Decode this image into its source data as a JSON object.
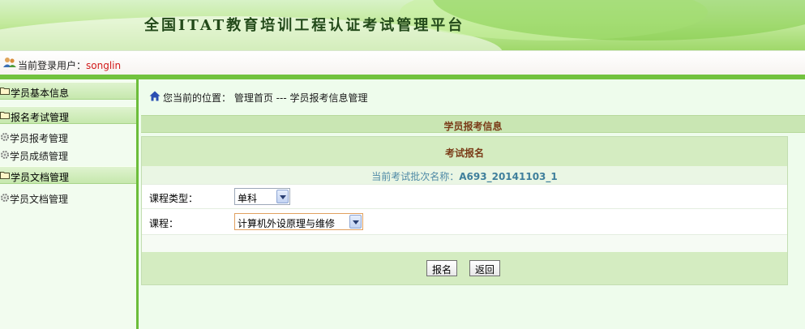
{
  "header": {
    "title": "全国ITAT教育培训工程认证考试管理平台"
  },
  "userbar": {
    "label": "当前登录用户：",
    "username": "songlin",
    "icon": "users-icon"
  },
  "sidebar": {
    "sections": [
      {
        "label": "学员基本信息",
        "icon": "folder-icon"
      },
      {
        "label": "报名考试管理",
        "icon": "folder-icon"
      },
      {
        "label": "学员文档管理",
        "icon": "folder-icon"
      }
    ],
    "items": [
      {
        "label": "学员报考管理",
        "icon": "gear-icon"
      },
      {
        "label": "学员成绩管理",
        "icon": "gear-icon"
      },
      {
        "label": "学员文档管理",
        "icon": "gear-icon"
      }
    ]
  },
  "breadcrumb": {
    "prefix": "您当前的位置：",
    "path": "管理首页 --- 学员报考信息管理",
    "icon": "home-icon"
  },
  "main": {
    "section_title": "学员报考信息",
    "panel_title": "考试报名",
    "batch_label": "当前考试批次名称：",
    "batch_value": "A693_20141103_1",
    "course_type_label": "课程类型：",
    "course_type_value": "单科",
    "course_label": "课程：",
    "course_value": "计算机外设原理与维修",
    "submit_label": "报名",
    "back_label": "返回"
  },
  "colors": {
    "accent_green": "#72c23e",
    "title_brown": "#7a3c18",
    "username_red": "#d21a1a",
    "batch_blue": "#3f7f9c"
  }
}
